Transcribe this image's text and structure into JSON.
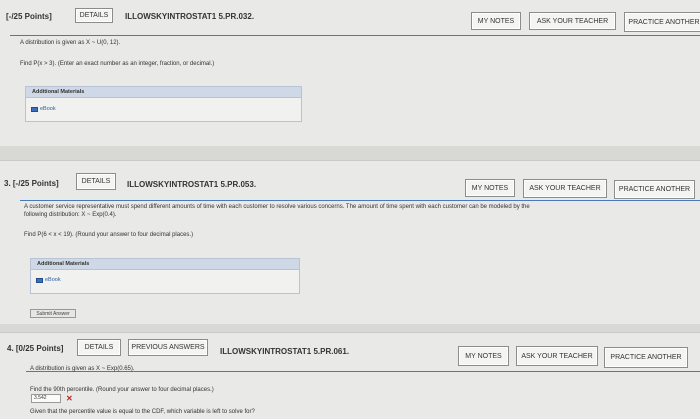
{
  "colors": {
    "accent": "#4a79b8",
    "error": "#c81e1e",
    "panel_header": "#cfd8e6",
    "page_bg": "#e9e9e7"
  },
  "questions": [
    {
      "points": "[-/25 Points]",
      "details_label": "DETAILS",
      "question_id": "ILLOWSKYINTROSTAT1 5.PR.032.",
      "my_notes": "MY NOTES",
      "ask_teacher": "ASK YOUR TEACHER",
      "practice_another": "PRACTICE ANOTHER",
      "line1": "A distribution is given as  X ~ U(0, 12).",
      "line2": "Find  P(x > 3).  (Enter an exact number as an integer, fraction, or decimal.)",
      "materials_title": "Additional Materials",
      "ebook_label": "eBook"
    },
    {
      "points": "3.  [-/25 Points]",
      "details_label": "DETAILS",
      "question_id": "ILLOWSKYINTROSTAT1 5.PR.053.",
      "my_notes": "MY NOTES",
      "ask_teacher": "ASK YOUR TEACHER",
      "practice_another": "PRACTICE ANOTHER",
      "line1": "A customer service representative must spend different amounts of time with each customer to resolve various concerns. The amount of time spent with each customer can be modeled by the",
      "line1b": "following distribution:  X ~ Exp(0.4).",
      "line2": "Find  P(6 < x < 19).  (Round your answer to four decimal places.)",
      "materials_title": "Additional Materials",
      "ebook_label": "eBook",
      "submit_label": "Submit Answer"
    },
    {
      "points": "4.  [0/25 Points]",
      "details_label": "DETAILS",
      "previous_answers": "PREVIOUS ANSWERS",
      "question_id": "ILLOWSKYINTROSTAT1 5.PR.061.",
      "my_notes": "MY NOTES",
      "ask_teacher": "ASK YOUR TEACHER",
      "practice_another": "PRACTICE ANOTHER",
      "line1": "A distribution is given as  X ~ Exp(0.65).",
      "line2": "Find the 90th percentile. (Round your answer to four decimal places.)",
      "answer_value": "3.542",
      "line3": "Given that the percentile value is equal to the CDF, which variable is left to solve for?"
    }
  ]
}
